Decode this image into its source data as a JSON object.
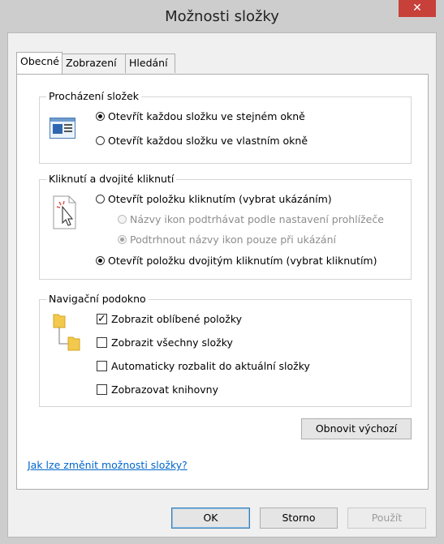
{
  "window": {
    "title": "Možnosti složky",
    "close_glyph": "✕"
  },
  "tabs": [
    {
      "label": "Obecné",
      "active": true
    },
    {
      "label": "Zobrazení",
      "active": false
    },
    {
      "label": "Hledání",
      "active": false
    }
  ],
  "browse_folders": {
    "legend": "Procházení složek",
    "option_same": "Otevřít každou složku ve stejném okně",
    "option_own": "Otevřít každou složku ve vlastním okně",
    "selected": "same"
  },
  "click": {
    "legend": "Kliknutí a dvojité kliknutí",
    "option_single": "Otevřít položku kliknutím (vybrat ukázáním)",
    "sub_browser": "Názvy ikon podtrhávat podle nastavení prohlížeče",
    "sub_point": "Podtrhnout názvy ikon pouze při ukázání",
    "option_double": "Otevřít položku dvojitým kliknutím (vybrat kliknutím)",
    "selected": "double"
  },
  "nav_pane": {
    "legend": "Navigační podokno",
    "show_favorites": "Zobrazit oblíbené položky",
    "show_all": "Zobrazit všechny složky",
    "auto_expand": "Automaticky rozbalit do aktuální složky",
    "show_libraries": "Zobrazovat knihovny",
    "checked": {
      "show_favorites": true,
      "show_all": false,
      "auto_expand": false,
      "show_libraries": false
    }
  },
  "restore_defaults": "Obnovit výchozí",
  "help_link": "Jak lze změnit možnosti složky?",
  "buttons": {
    "ok": "OK",
    "cancel": "Storno",
    "apply": "Použít"
  },
  "colors": {
    "close_red": "#c7403a",
    "link_blue": "#0066cc",
    "default_border": "#3c7fb1"
  }
}
